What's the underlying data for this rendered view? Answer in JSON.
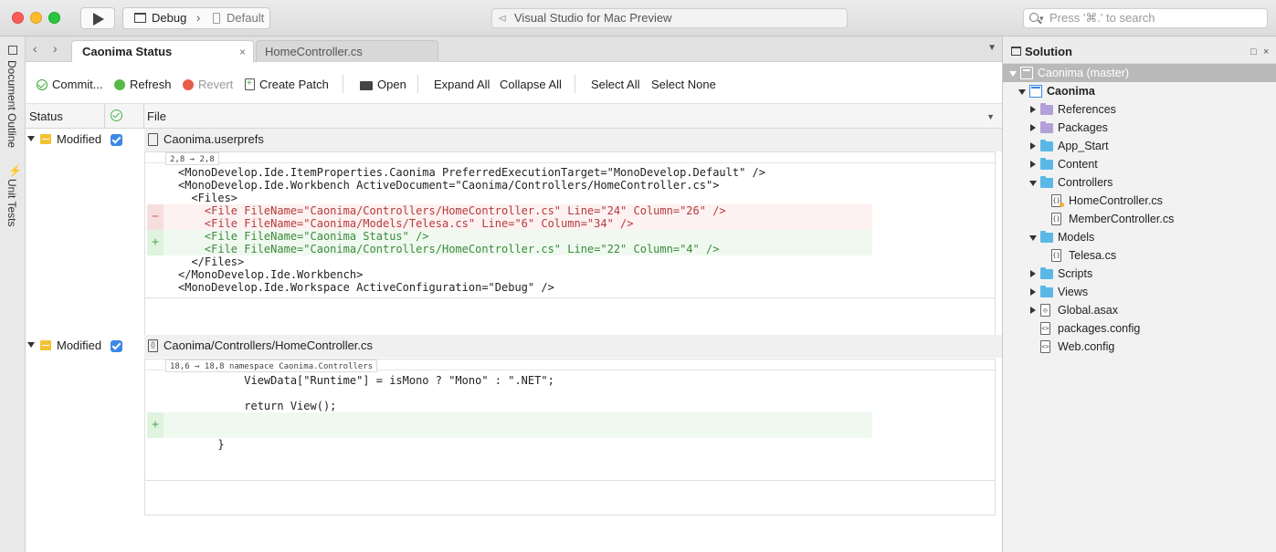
{
  "titlebar": {
    "configuration": "Debug",
    "separator": "›",
    "target": "Default",
    "window_title": "Visual Studio for Mac Preview",
    "search_placeholder": "Press '⌘.' to search",
    "vs_icon_glyph": "⊲"
  },
  "left_strip": {
    "document_outline": "Document Outline",
    "unit_tests": "Unit Tests"
  },
  "tabs": {
    "back": "‹",
    "forward": "›",
    "active": "Caonima Status",
    "inactive": "HomeController.cs",
    "close_glyph": "×",
    "dropdown_glyph": "▼"
  },
  "toolbar": {
    "commit": "Commit...",
    "refresh": "Refresh",
    "revert": "Revert",
    "create_patch": "Create Patch",
    "open": "Open",
    "expand_all": "Expand All",
    "collapse_all": "Collapse All",
    "select_all": "Select All",
    "select_none": "Select None"
  },
  "columns": {
    "status": "Status",
    "file": "File",
    "sort_glyph": "▼"
  },
  "files": [
    {
      "status": "Modified",
      "checked": true,
      "icon_glyph": "",
      "name": "Caonima.userprefs",
      "hunk": "2,8 → 2,8",
      "lines": [
        {
          "type": "ctx",
          "text": "<MonoDevelop.Ide.ItemProperties.Caonima PreferredExecutionTarget=\"MonoDevelop.Default\" />"
        },
        {
          "type": "ctx",
          "text": "<MonoDevelop.Ide.Workbench ActiveDocument=\"Caonima/Controllers/HomeController.cs\">"
        },
        {
          "type": "ctx",
          "text": "  <Files>"
        },
        {
          "type": "del",
          "text": "    <File FileName=\"Caonima/Controllers/HomeController.cs\" Line=\"24\" Column=\"26\" />"
        },
        {
          "type": "del",
          "text": "    <File FileName=\"Caonima/Models/Telesa.cs\" Line=\"6\" Column=\"34\" />"
        },
        {
          "type": "add",
          "text": "    <File FileName=\"Caonima Status\" />"
        },
        {
          "type": "add",
          "text": "    <File FileName=\"Caonima/Controllers/HomeController.cs\" Line=\"22\" Column=\"4\" />"
        },
        {
          "type": "ctx",
          "text": "  </Files>"
        },
        {
          "type": "ctx",
          "text": "</MonoDevelop.Ide.Workbench>"
        },
        {
          "type": "ctx",
          "text": "<MonoDevelop.Ide.Workspace ActiveConfiguration=\"Debug\" />"
        }
      ],
      "gutter_minus": "−",
      "gutter_plus": "+"
    },
    {
      "status": "Modified",
      "checked": true,
      "icon_glyph": "{}",
      "name": "Caonima/Controllers/HomeController.cs",
      "hunk": "18,6 → 18,8  namespace Caonima.Controllers",
      "lines": [
        {
          "type": "ctx",
          "text": "          ViewData[\"Runtime\"] = isMono ? \"Mono\" : \".NET\";"
        },
        {
          "type": "ctx",
          "text": ""
        },
        {
          "type": "ctx",
          "text": "          return View();"
        },
        {
          "type": "add",
          "text": ""
        },
        {
          "type": "add",
          "text": ""
        },
        {
          "type": "ctx",
          "text": ""
        },
        {
          "type": "ctx",
          "text": "      }"
        }
      ],
      "gutter_plus": "+"
    }
  ],
  "solution": {
    "title": "Solution",
    "pin_glyph": "□",
    "close_glyph": "×",
    "items": [
      {
        "label": "Caonima (master)",
        "kind": "solution",
        "level": 0,
        "expanded": true,
        "selected": true
      },
      {
        "label": "Caonima",
        "kind": "project",
        "level": 1,
        "expanded": true,
        "bold": true
      },
      {
        "label": "References",
        "kind": "ref-folder",
        "level": 2,
        "expanded": false
      },
      {
        "label": "Packages",
        "kind": "ref-folder",
        "level": 2,
        "expanded": false
      },
      {
        "label": "App_Start",
        "kind": "folder",
        "level": 2,
        "expanded": false
      },
      {
        "label": "Content",
        "kind": "folder",
        "level": 2,
        "expanded": false
      },
      {
        "label": "Controllers",
        "kind": "folder",
        "level": 2,
        "expanded": true
      },
      {
        "label": "HomeController.cs",
        "kind": "cs",
        "level": 3,
        "modified": true
      },
      {
        "label": "MemberController.cs",
        "kind": "cs",
        "level": 3
      },
      {
        "label": "Models",
        "kind": "folder",
        "level": 2,
        "expanded": true
      },
      {
        "label": "Telesa.cs",
        "kind": "cs",
        "level": 3
      },
      {
        "label": "Scripts",
        "kind": "folder",
        "level": 2,
        "expanded": false
      },
      {
        "label": "Views",
        "kind": "folder",
        "level": 2,
        "expanded": false
      },
      {
        "label": "Global.asax",
        "kind": "asax",
        "level": 2,
        "expanded": false
      },
      {
        "label": "packages.config",
        "kind": "config",
        "level": 2
      },
      {
        "label": "Web.config",
        "kind": "config",
        "level": 2
      }
    ]
  },
  "colors": {
    "accent": "#3d87e6",
    "modified": "#f3c233",
    "added": "#3b8a3b",
    "removed": "#b33c3c"
  }
}
